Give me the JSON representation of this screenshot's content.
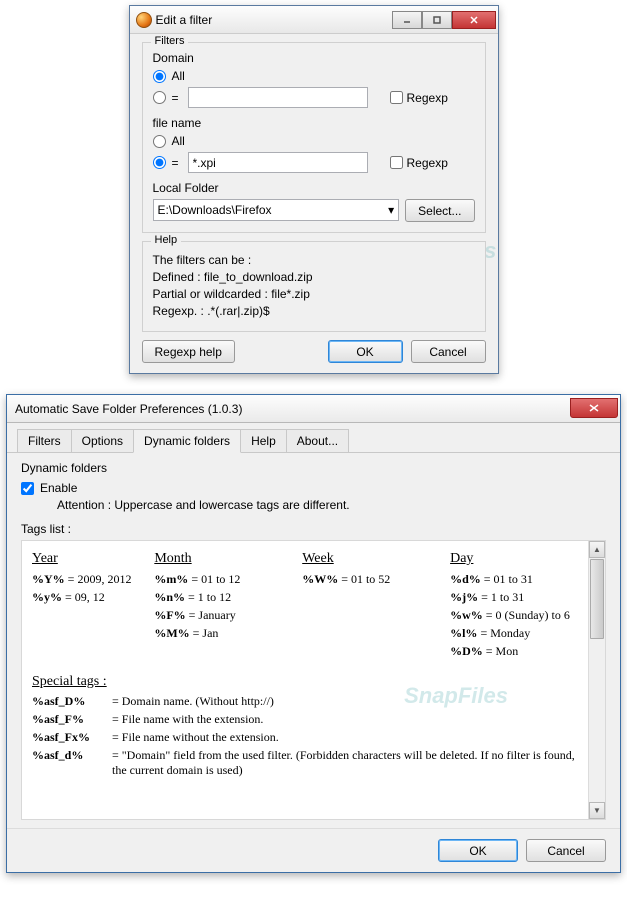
{
  "window1": {
    "title": "Edit a filter",
    "filters_label": "Filters",
    "domain_label": "Domain",
    "all_label": "All",
    "eq_label": "=",
    "regexp_label": "Regexp",
    "domain_value": "",
    "filename_label": "file name",
    "filename_value": "*.xpi",
    "localfolder_label": "Local Folder",
    "localfolder_value": "E:\\Downloads\\Firefox",
    "select_btn": "Select...",
    "help_label": "Help",
    "help1": "The filters can be :",
    "help2": "Defined : file_to_download.zip",
    "help3": "Partial or wildcarded : file*.zip",
    "help4": "Regexp. : .*(.rar|.zip)$",
    "regexp_help_btn": "Regexp help",
    "ok_btn": "OK",
    "cancel_btn": "Cancel"
  },
  "window2": {
    "title": "Automatic Save Folder Preferences (1.0.3)",
    "tabs": [
      "Filters",
      "Options",
      "Dynamic folders",
      "Help",
      "About..."
    ],
    "heading": "Dynamic folders",
    "enable_label": "Enable",
    "attention": "Attention : Uppercase and lowercase tags are different.",
    "tags_list_label": "Tags list :",
    "cols": {
      "year": {
        "h": "Year",
        "lines": [
          "<b>%Y%</b> = 2009, 2012",
          "<b>%y%</b> = 09, 12"
        ]
      },
      "month": {
        "h": "Month",
        "lines": [
          "<b>%m%</b> = 01 to 12",
          "<b>%n%</b> = 1 to 12",
          "<b>%F%</b> = January",
          "<b>%M%</b> = Jan"
        ]
      },
      "week": {
        "h": "Week",
        "lines": [
          "<b>%W%</b> = 01 to 52"
        ]
      },
      "day": {
        "h": "Day",
        "lines": [
          "<b>%d%</b> = 01 to 31",
          "<b>%j%</b> = 1 to 31",
          "<b>%w%</b> = 0 (Sunday) to 6",
          "<b>%l%</b> = Monday",
          "<b>%D%</b> = Mon"
        ]
      }
    },
    "special_h": "Special tags :",
    "special": [
      {
        "k": "%asf_D%",
        "v": "= Domain name. (Without http://)"
      },
      {
        "k": "%asf_F%",
        "v": "= File name with the extension."
      },
      {
        "k": "%asf_Fx%",
        "v": "= File name without the extension."
      },
      {
        "k": "%asf_d%",
        "v": "= \"Domain\" field from the used filter. (Forbidden characters will be deleted. If no filter is found, the current domain is used)"
      }
    ],
    "ok_btn": "OK",
    "cancel_btn": "Cancel"
  }
}
